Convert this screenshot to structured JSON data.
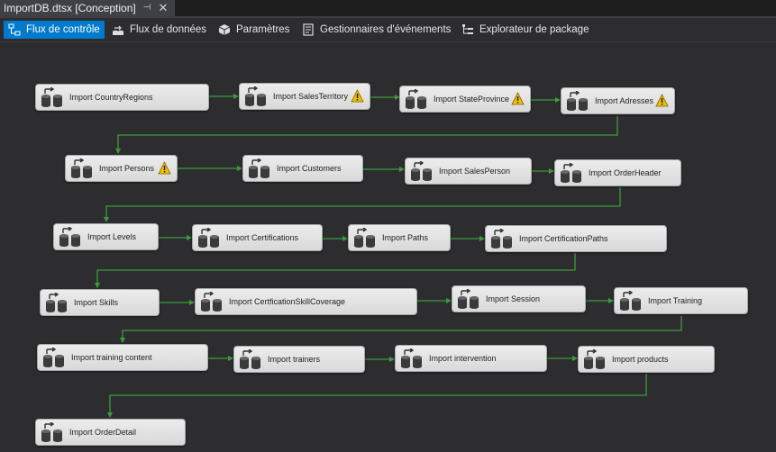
{
  "document_tab": {
    "title": "ImportDB.dtsx [Conception]",
    "pin_icon": "pin-icon",
    "close_icon": "close-icon"
  },
  "toolbar": {
    "tabs": [
      {
        "label": "Flux de contrôle",
        "icon": "control-flow-icon",
        "active": true
      },
      {
        "label": "Flux de données",
        "icon": "data-flow-icon",
        "active": false
      },
      {
        "label": "Paramètres",
        "icon": "parameters-icon",
        "active": false
      },
      {
        "label": "Gestionnaires d'événements",
        "icon": "event-handlers-icon",
        "active": false
      },
      {
        "label": "Explorateur de package",
        "icon": "package-explorer-icon",
        "active": false
      }
    ]
  },
  "tasks": [
    {
      "label": "Import CountryRegions",
      "warning": false
    },
    {
      "label": "Import SalesTerritory",
      "warning": true
    },
    {
      "label": "Import StateProvince",
      "warning": true
    },
    {
      "label": "Import Adresses",
      "warning": true
    },
    {
      "label": "Import Persons",
      "warning": true
    },
    {
      "label": "Import Customers",
      "warning": false
    },
    {
      "label": "Import SalesPerson",
      "warning": false
    },
    {
      "label": "Import OrderHeader",
      "warning": false
    },
    {
      "label": "Import Levels",
      "warning": false
    },
    {
      "label": "Import Certifications",
      "warning": false
    },
    {
      "label": "Import Paths",
      "warning": false
    },
    {
      "label": "Import CertificationPaths",
      "warning": false
    },
    {
      "label": "Import Skills",
      "warning": false
    },
    {
      "label": "Import CertficationSkillCoverage",
      "warning": false
    },
    {
      "label": "Import Session",
      "warning": false
    },
    {
      "label": "Import Training",
      "warning": false
    },
    {
      "label": "Import training content",
      "warning": false
    },
    {
      "label": "Import trainers",
      "warning": false
    },
    {
      "label": "Import intervention",
      "warning": false
    },
    {
      "label": "Import products",
      "warning": false
    },
    {
      "label": "Import OrderDetail",
      "warning": false
    }
  ],
  "task_icon": "data-flow-task-icon",
  "warning_icon": "warning-icon",
  "colors": {
    "canvas": "#2d2d30",
    "precedence_constraint": "#3c9a3c",
    "active_tab": "#007acc",
    "warning": "#f0c000"
  }
}
